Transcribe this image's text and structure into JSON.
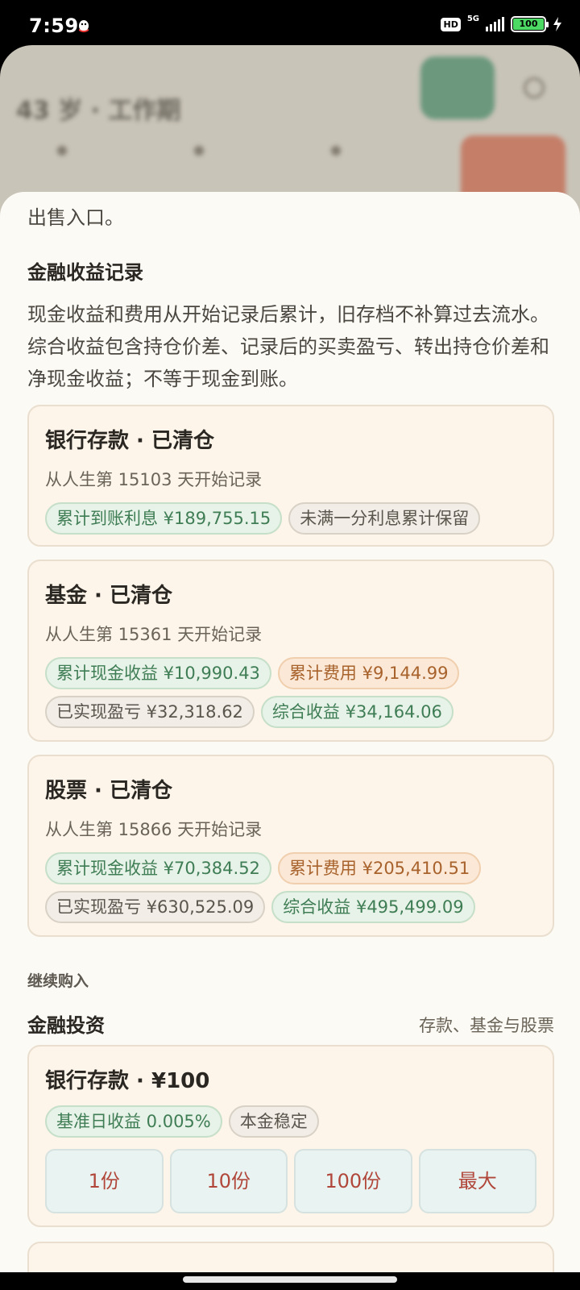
{
  "status_bar": {
    "time": "7:59",
    "hd": "HD",
    "network": "5G",
    "battery": "100"
  },
  "background_app": {
    "crumb": "",
    "title": "43 岁 · 工作期",
    "primary_button": "",
    "red_button": ""
  },
  "sheet": {
    "intro_tail": "出售入口。",
    "finance_record": {
      "heading": "金融收益记录",
      "description": "现金收益和费用从开始记录后累计，旧存档不补算过去流水。综合收益包含持仓价差、记录后的买卖盈亏、转出持仓价差和净现金收益；不等于现金到账。"
    },
    "records": [
      {
        "title": "银行存款 · 已清仓",
        "since": "从人生第 15103 天开始记录",
        "chips": [
          {
            "text": "累计到账利息 ¥189,755.15",
            "tone": "green"
          },
          {
            "text": "未满一分利息累计保留",
            "tone": "neutral"
          }
        ]
      },
      {
        "title": "基金 · 已清仓",
        "since": "从人生第 15361 天开始记录",
        "chips": [
          {
            "text": "累计现金收益 ¥10,990.43",
            "tone": "green"
          },
          {
            "text": "累计费用 ¥9,144.99",
            "tone": "orange"
          },
          {
            "text": "已实现盈亏 ¥32,318.62",
            "tone": "neutral"
          },
          {
            "text": "综合收益 ¥34,164.06",
            "tone": "green"
          }
        ]
      },
      {
        "title": "股票 · 已清仓",
        "since": "从人生第 15866 天开始记录",
        "chips": [
          {
            "text": "累计现金收益 ¥70,384.52",
            "tone": "green"
          },
          {
            "text": "累计费用 ¥205,410.51",
            "tone": "orange"
          },
          {
            "text": "已实现盈亏 ¥630,525.09",
            "tone": "neutral"
          },
          {
            "text": "综合收益 ¥495,499.09",
            "tone": "green"
          }
        ]
      }
    ],
    "continue_label": "继续购入",
    "investment": {
      "heading": "金融投资",
      "right_note": "存款、基金与股票",
      "deposit": {
        "title": "银行存款 · ¥100",
        "chips": [
          {
            "text": "基准日收益 0.005%",
            "tone": "green"
          },
          {
            "text": "本金稳定",
            "tone": "neutral"
          }
        ],
        "buttons": [
          "1份",
          "10份",
          "100份",
          "最大"
        ]
      }
    }
  }
}
